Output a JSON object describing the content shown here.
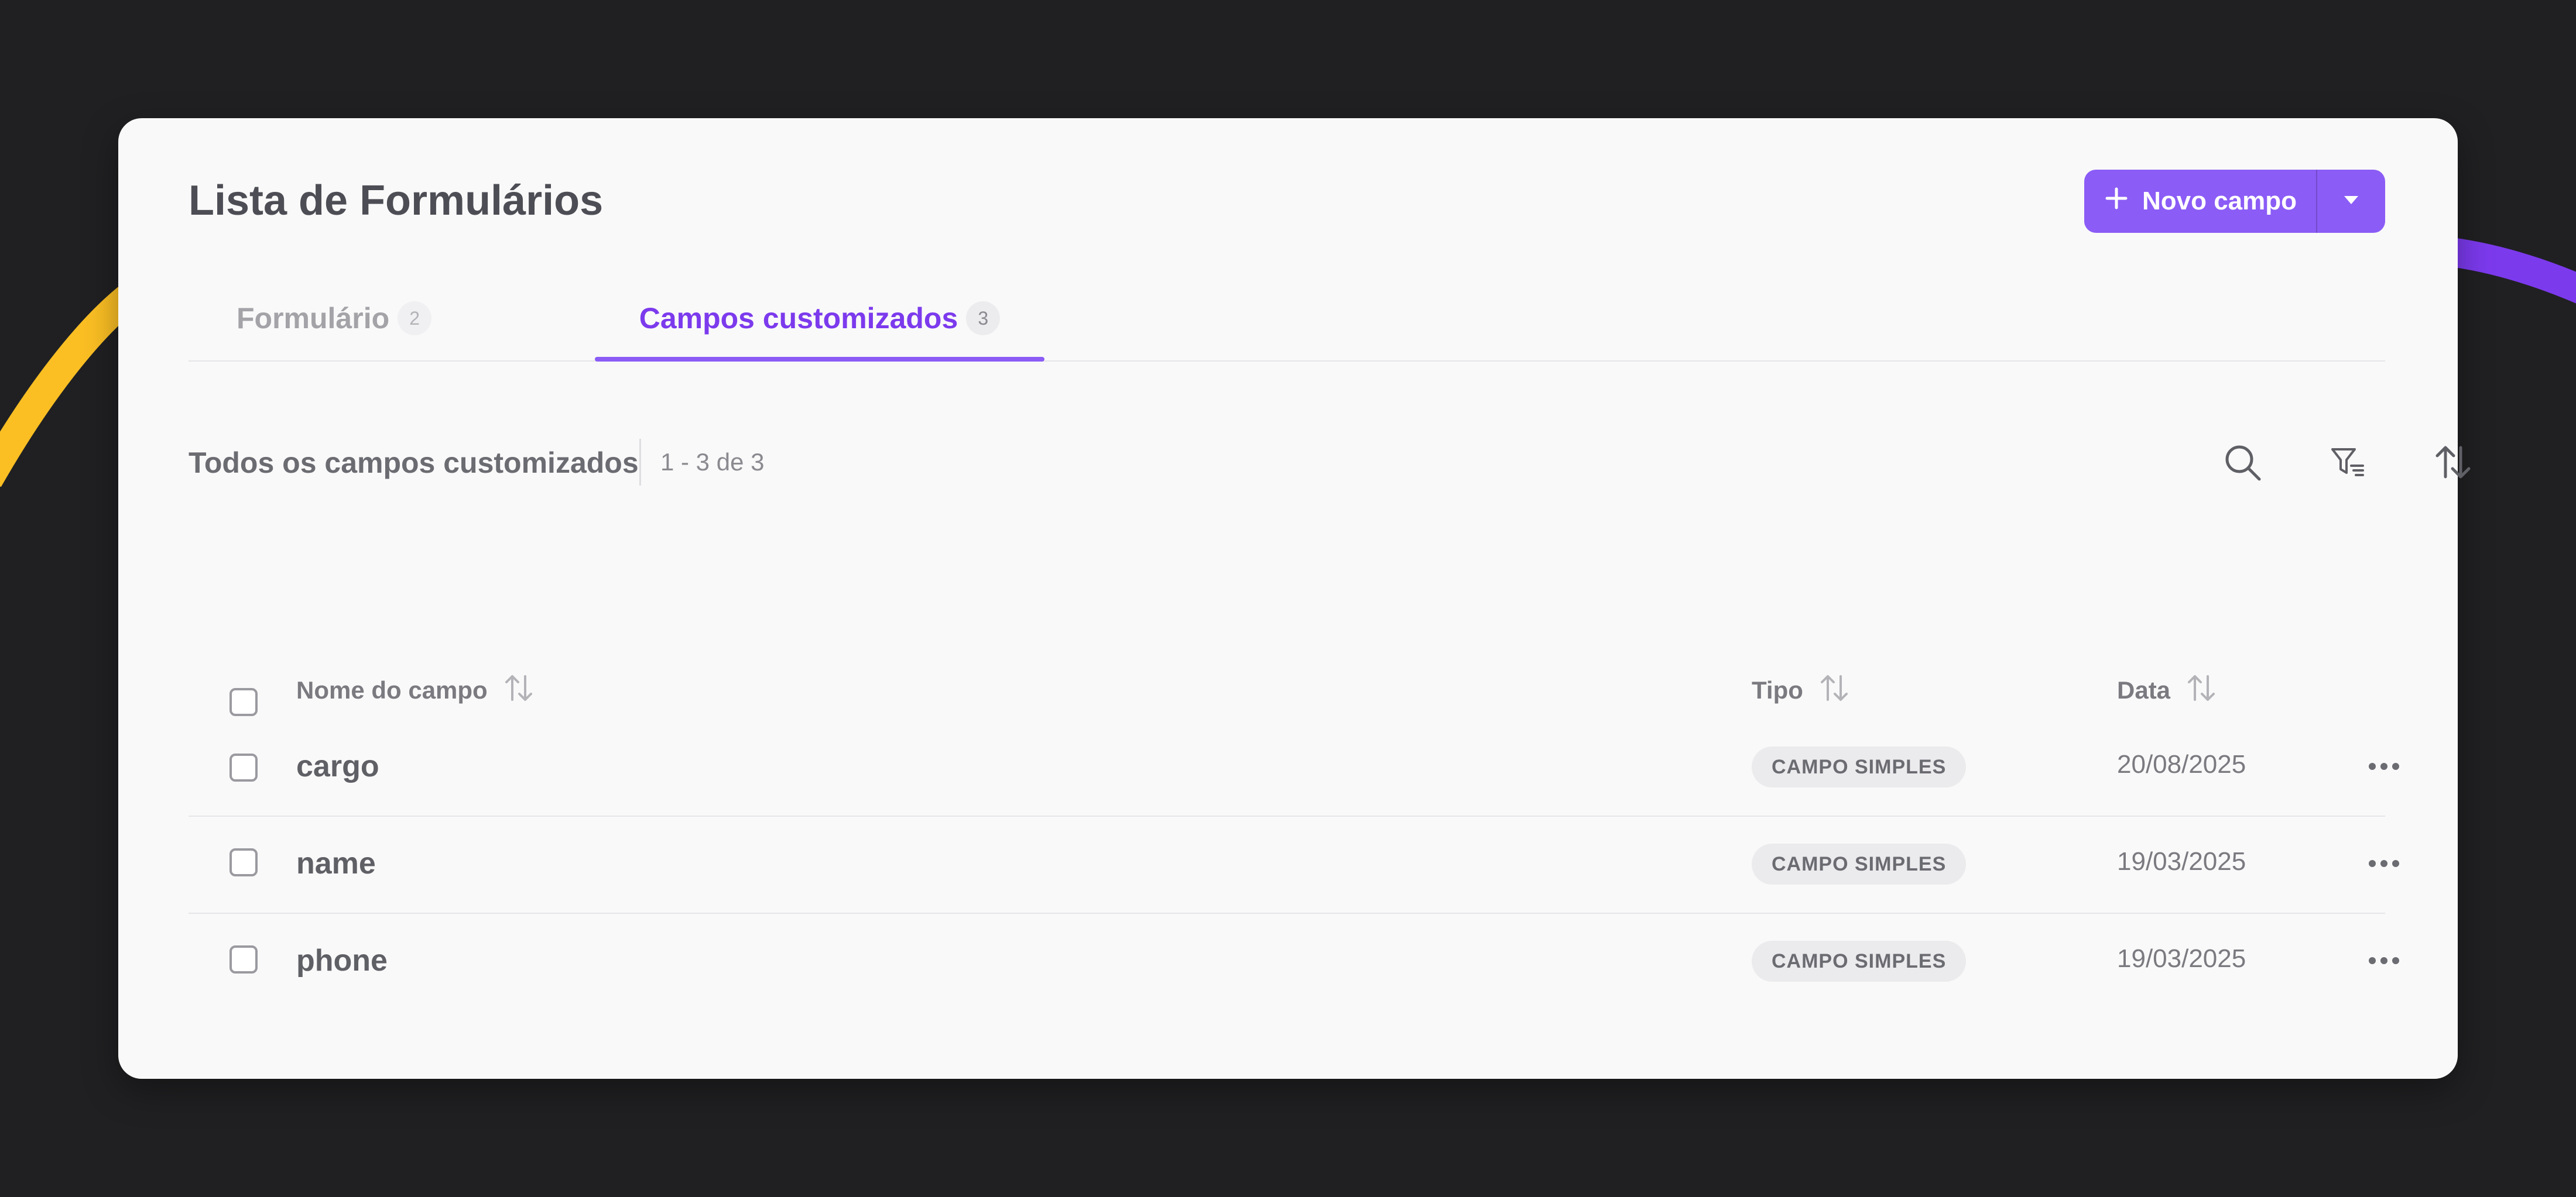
{
  "header": {
    "title": "Lista de Formulários",
    "new_button_label": "Novo campo"
  },
  "tabs": [
    {
      "label": "Formulário",
      "count": "2",
      "active": false
    },
    {
      "label": "Campos customizados",
      "count": "3",
      "active": true
    }
  ],
  "section": {
    "title": "Todos os campos customizados",
    "range": "1 - 3 de 3"
  },
  "table": {
    "columns": [
      "Nome do campo",
      "Tipo",
      "Data"
    ],
    "rows": [
      {
        "name": "cargo",
        "type": "CAMPO SIMPLES",
        "date": "20/08/2025"
      },
      {
        "name": "name",
        "type": "CAMPO SIMPLES",
        "date": "19/03/2025"
      },
      {
        "name": "phone",
        "type": "CAMPO SIMPLES",
        "date": "19/03/2025"
      }
    ]
  },
  "icons": {
    "new_button": "plus-icon",
    "split_caret": "caret-down-icon",
    "toolbar": [
      "search-icon",
      "filter-icon",
      "sort-icon"
    ],
    "column_sort": "sort-arrows-icon",
    "row_actions": "more-horizontal-icon"
  },
  "colors": {
    "background": "#202022",
    "card": "#f9f9f9",
    "accent": "#8b5cf6",
    "accent_text": "#7c3aed",
    "deco_yellow": "#fbbf24",
    "deco_purple": "#7c3aed"
  }
}
